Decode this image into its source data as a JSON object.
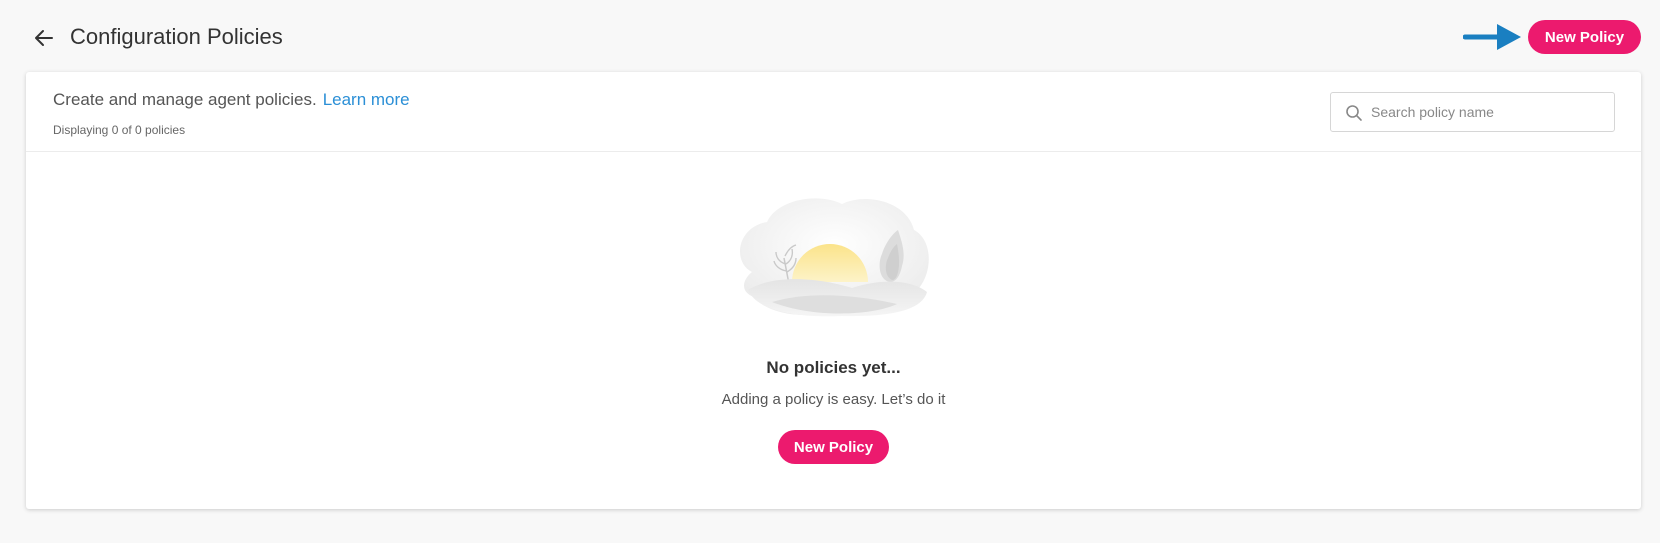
{
  "header": {
    "title": "Configuration Policies",
    "back_icon": "arrow-left-icon",
    "new_policy_label": "New Policy"
  },
  "intro": {
    "text": "Create and manage agent policies.",
    "learn_more": "Learn more",
    "count_text": "Displaying 0 of 0 policies"
  },
  "search": {
    "placeholder": "Search policy name",
    "value": "",
    "icon": "search-icon"
  },
  "empty_state": {
    "illustration": "sunset-landscape-illustration",
    "title": "No policies yet...",
    "subtitle": "Adding a policy is easy. Let’s do it",
    "button_label": "New Policy"
  },
  "colors": {
    "accent": "#ec1a6e",
    "link": "#2b8fd6",
    "callout_arrow": "#1a7fc1",
    "page_bg": "#f8f8f8",
    "card_bg": "#ffffff"
  }
}
